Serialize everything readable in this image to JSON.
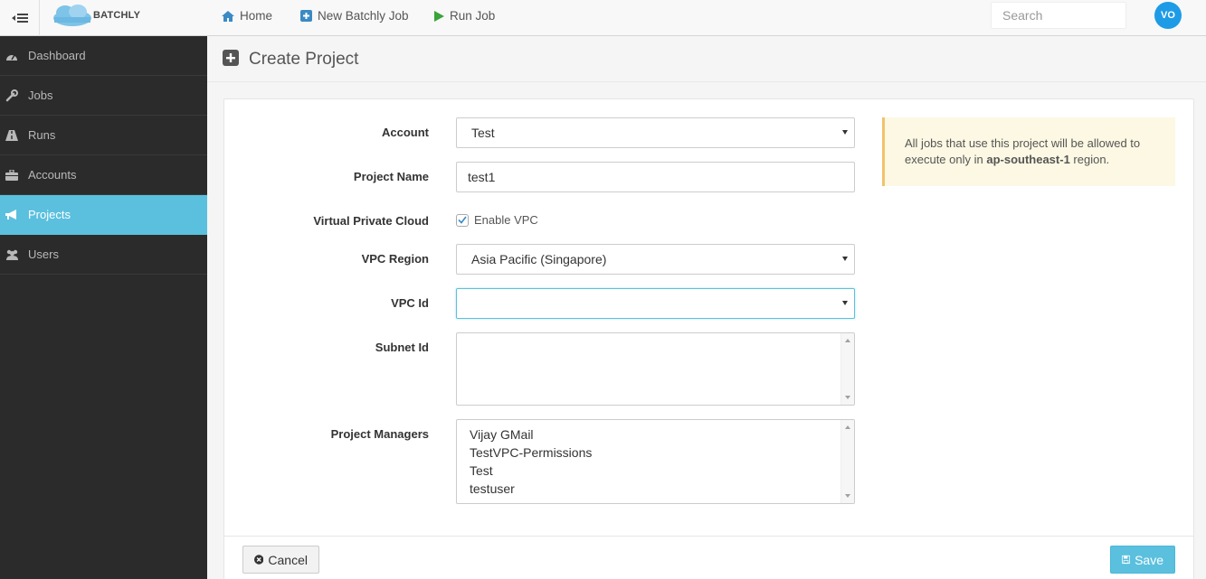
{
  "header": {
    "brand": "BATCHLY",
    "nav": [
      {
        "label": "Home",
        "icon": "home-icon"
      },
      {
        "label": "New Batchly Job",
        "icon": "plus-square-icon"
      },
      {
        "label": "Run Job",
        "icon": "play-icon"
      }
    ],
    "search_placeholder": "Search",
    "avatar_initials": "VO"
  },
  "sidebar": {
    "items": [
      {
        "label": "Dashboard",
        "icon": "dashboard-icon"
      },
      {
        "label": "Jobs",
        "icon": "wrench-icon"
      },
      {
        "label": "Runs",
        "icon": "road-icon"
      },
      {
        "label": "Accounts",
        "icon": "briefcase-icon"
      },
      {
        "label": "Projects",
        "icon": "bullhorn-icon",
        "active": true
      },
      {
        "label": "Users",
        "icon": "users-icon"
      }
    ]
  },
  "page": {
    "title": "Create Project"
  },
  "form": {
    "account": {
      "label": "Account",
      "value": "Test"
    },
    "project_name": {
      "label": "Project Name",
      "value": "test1"
    },
    "vpc": {
      "label": "Virtual Private Cloud",
      "checkbox_label": "Enable VPC",
      "checked": true
    },
    "vpc_region": {
      "label": "VPC Region",
      "value": "Asia Pacific (Singapore)"
    },
    "vpc_id": {
      "label": "VPC Id",
      "value": ""
    },
    "subnet_id": {
      "label": "Subnet Id"
    },
    "project_managers": {
      "label": "Project Managers",
      "options": [
        "Vijay GMail",
        "TestVPC-Permissions",
        "Test",
        "testuser"
      ]
    }
  },
  "alert": {
    "text_before": "All jobs that use this project will be allowed to execute only in ",
    "region": "ap-southeast-1",
    "text_after": " region."
  },
  "footer": {
    "cancel_label": "Cancel",
    "save_label": "Save"
  },
  "colors": {
    "accent": "#5bc0de",
    "sidebar_bg": "#2b2b2b",
    "alert_bg": "#fcf8e3",
    "avatar_bg": "#1e9be6"
  }
}
